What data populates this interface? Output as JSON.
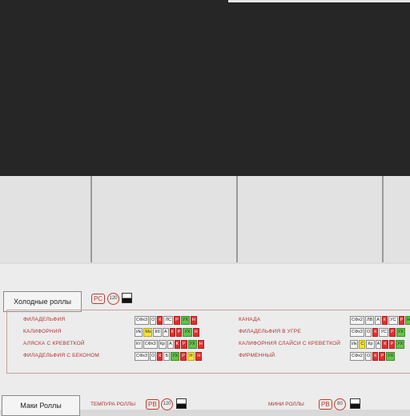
{
  "sections": {
    "cold_rolls": {
      "title": "Холодные роллы",
      "badge": "РС",
      "circle": "120",
      "left_items": [
        {
          "name": "ФИЛАДЕЛЬФИЯ",
          "codes": [
            [
              "СФх3",
              ""
            ],
            [
              "О",
              ""
            ],
            [
              "К",
              "r"
            ],
            [
              "ЛС",
              ""
            ],
            [
              "Р",
              "r"
            ],
            [
              "УХ",
              "g"
            ],
            [
              "Н",
              "r"
            ]
          ]
        },
        {
          "name": "КАЛИФОРНИЯ",
          "codes": [
            [
              "Ик",
              ""
            ],
            [
              "Мз",
              "y"
            ],
            [
              "Кб",
              ""
            ],
            [
              "А",
              ""
            ],
            [
              "К",
              "r"
            ],
            [
              "Р",
              "r"
            ],
            [
              "УХ",
              "g"
            ],
            [
              "Н",
              "r"
            ]
          ]
        },
        {
          "name": "АЛЯСКА С КРЕВЕТКОЙ",
          "codes": [
            [
              "Кт",
              ""
            ],
            [
              "СФх3",
              ""
            ],
            [
              "Кр",
              ""
            ],
            [
              "А",
              ""
            ],
            [
              "К",
              "r"
            ],
            [
              "Р",
              "r"
            ],
            [
              "УХ",
              "g"
            ],
            [
              "Н",
              "r"
            ]
          ]
        },
        {
          "name": "ФИЛАДЕЛЬФИЯ С БЕКОНОМ",
          "codes": [
            [
              "СФх3",
              ""
            ],
            [
              "О",
              ""
            ],
            [
              "К",
              "r"
            ],
            [
              "Б",
              ""
            ],
            [
              "УХ",
              "g"
            ],
            [
              "Р",
              "r"
            ],
            [
              "Уг",
              "y"
            ],
            [
              "Н",
              "r"
            ]
          ]
        }
      ],
      "right_items": [
        {
          "name": "КАНАДА",
          "codes": [
            [
              "СФх2",
              ""
            ],
            [
              "ЛВ",
              ""
            ],
            [
              "А",
              ""
            ],
            [
              "К",
              "r"
            ],
            [
              "УС",
              ""
            ],
            [
              "Р",
              "r"
            ],
            [
              "Н",
              "g"
            ]
          ]
        },
        {
          "name": "ФИЛАДЕЛЬФИЯ В УГРЕ",
          "codes": [
            [
              "СФх3",
              ""
            ],
            [
              "О",
              ""
            ],
            [
              "К",
              "r"
            ],
            [
              "УС",
              ""
            ],
            [
              "Р",
              "r"
            ],
            [
              "УХ",
              "g"
            ]
          ]
        },
        {
          "name": "КАЛИФОРНИЯ СЛАЙСИ С КРЕВЕТКОЙ",
          "codes": [
            [
              "Ик",
              ""
            ],
            [
              "С",
              "y"
            ],
            [
              "Кр",
              ""
            ],
            [
              "А",
              ""
            ],
            [
              "К",
              "r"
            ],
            [
              "Р",
              "r"
            ],
            [
              "УХ",
              "g"
            ]
          ]
        },
        {
          "name": "ФИРМЕННЫЙ",
          "codes": [
            [
              "СФх2",
              ""
            ],
            [
              "О",
              ""
            ],
            [
              "К",
              "r"
            ],
            [
              "Р",
              "r"
            ],
            [
              "УХ",
              "g"
            ]
          ]
        }
      ]
    },
    "maki": {
      "title": "Маки Роллы",
      "tempura_label": "ТЕМПУРА РОЛЛЫ",
      "tempura_badge": "РВ",
      "tempura_circle": "120",
      "mini_label": "МИНИ РОЛЛЫ",
      "mini_badge": "РВ",
      "mini_circle": "80"
    }
  }
}
